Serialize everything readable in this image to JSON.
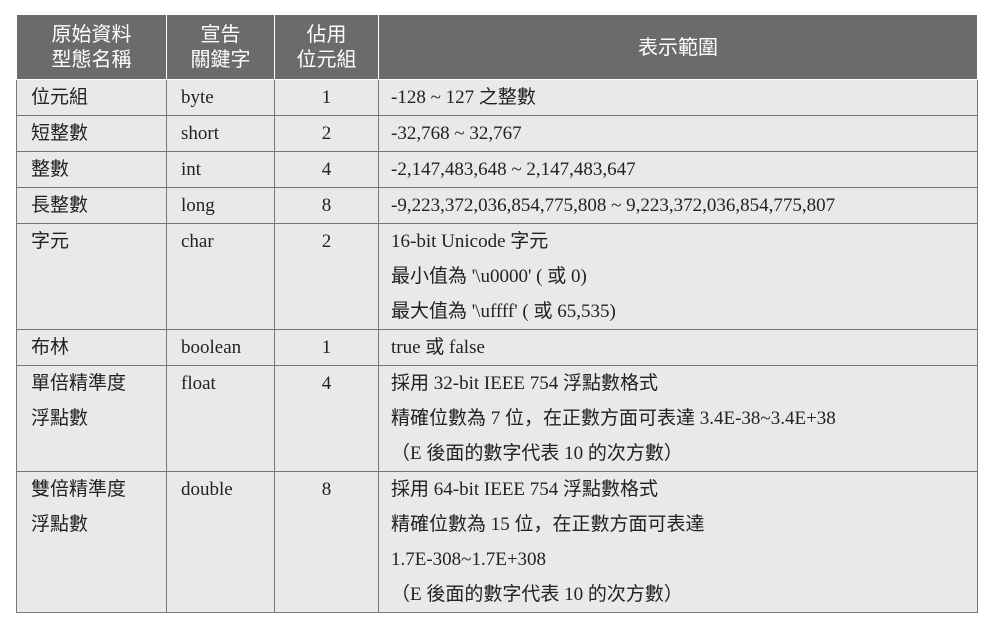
{
  "headers": {
    "type_name": [
      "原始資料",
      "型態名稱"
    ],
    "keyword": [
      "宣告",
      "關鍵字"
    ],
    "size": [
      "佔用",
      "位元組"
    ],
    "range": "表示範圍"
  },
  "rows": [
    {
      "name": [
        "位元組"
      ],
      "keyword": "byte",
      "size": "1",
      "range": [
        "-128 ~ 127 之整數"
      ]
    },
    {
      "name": [
        "短整數"
      ],
      "keyword": "short",
      "size": "2",
      "range": [
        "-32,768 ~ 32,767"
      ]
    },
    {
      "name": [
        "整數"
      ],
      "keyword": "int",
      "size": "4",
      "range": [
        "-2,147,483,648 ~ 2,147,483,647"
      ]
    },
    {
      "name": [
        "長整數"
      ],
      "keyword": "long",
      "size": "8",
      "range": [
        "-9,223,372,036,854,775,808 ~ 9,223,372,036,854,775,807"
      ]
    },
    {
      "name": [
        "字元"
      ],
      "keyword": "char",
      "size": "2",
      "range": [
        "16-bit Unicode 字元",
        "最小值為 '\\u0000' ( 或 0)",
        "最大值為 '\\uffff' ( 或 65,535)"
      ]
    },
    {
      "name": [
        "布林"
      ],
      "keyword": "boolean",
      "size": "1",
      "range": [
        "true 或 false"
      ]
    },
    {
      "name": [
        "單倍精準度",
        "浮點數"
      ],
      "keyword": "float",
      "size": "4",
      "range": [
        "採用 32-bit IEEE 754 浮點數格式",
        "精確位數為 7 位，在正數方面可表達 3.4E-38~3.4E+38",
        "（E 後面的數字代表 10 的次方數）"
      ]
    },
    {
      "name": [
        "雙倍精準度",
        "浮點數"
      ],
      "keyword": "double",
      "size": "8",
      "range": [
        "採用 64-bit IEEE 754 浮點數格式",
        "精確位數為 15 位，在正數方面可表達",
        "1.7E-308~1.7E+308",
        "（E 後面的數字代表 10 的次方數）"
      ]
    }
  ]
}
